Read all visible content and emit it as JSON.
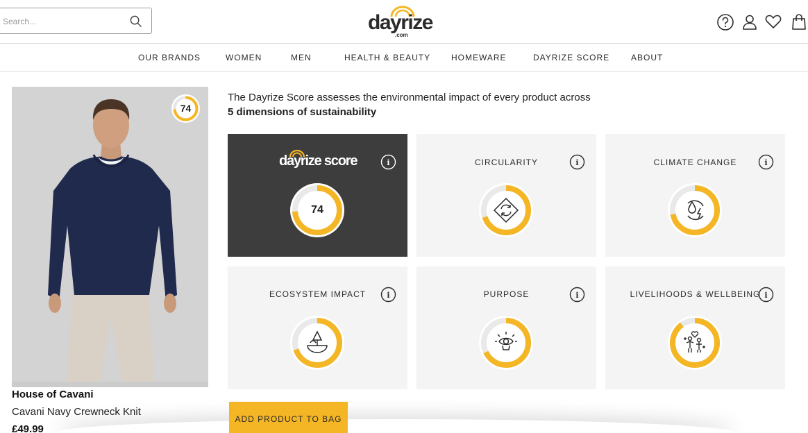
{
  "header": {
    "search": {
      "placeholder": "Search...",
      "value": ""
    },
    "logo": {
      "text": "dayrize",
      "subtext": ".com"
    },
    "icons": [
      "help-icon",
      "account-icon",
      "wishlist-icon",
      "bag-icon"
    ]
  },
  "nav": {
    "items": [
      "OUR BRANDS",
      "WOMEN",
      "MEN",
      "HEALTH & BEAUTY",
      "HOMEWARE",
      "DAYRIZE SCORE",
      "ABOUT"
    ]
  },
  "product": {
    "score": "74",
    "brand": "House of Cavani",
    "name": "Cavani Navy Crewneck Knit",
    "price": "£49.99"
  },
  "intro": {
    "line1": "The Dayrize Score assesses the environmental impact of every product across",
    "line2": "5 dimensions of sustainability"
  },
  "cards": {
    "score": {
      "logo_text": "dayrize score",
      "value": "74",
      "fill": 0.74
    },
    "circularity": {
      "title": "CIRCULARITY",
      "icon": "recycle-icon",
      "fill": 0.7
    },
    "climate": {
      "title": "CLIMATE CHANGE",
      "icon": "climate-icon",
      "fill": 0.72
    },
    "ecosystem": {
      "title": "ECOSYSTEM IMPACT",
      "icon": "ecosystem-icon",
      "fill": 0.7
    },
    "purpose": {
      "title": "PURPOSE",
      "icon": "purpose-icon",
      "fill": 0.68
    },
    "livelihoods": {
      "title": "LIVELIHOODS & WELLBEING",
      "icon": "livelihoods-icon",
      "fill": 0.9
    }
  },
  "actions": {
    "add_to_bag": "ADD PRODUCT TO BAG"
  },
  "colors": {
    "accent": "#f4b625",
    "dark_card": "#3d3d3d",
    "card_bg": "#f4f4f4"
  }
}
